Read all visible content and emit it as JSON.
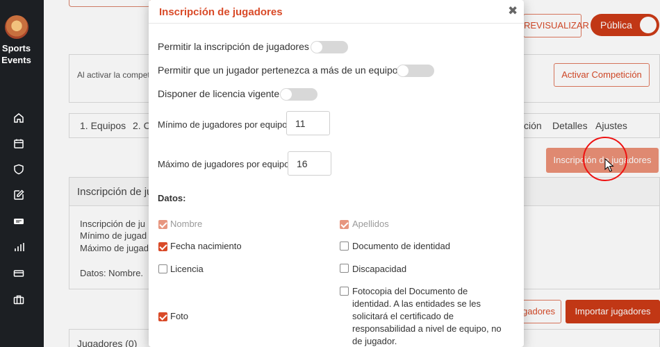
{
  "sidebar": {
    "brand": "Sports\nEvents",
    "brand_line1": "Sports",
    "brand_line2": "Events",
    "icons": [
      "home-icon",
      "calendar-icon",
      "shield-icon",
      "edit-icon",
      "ticket-icon",
      "bar-chart-icon",
      "card-icon",
      "briefcase-icon"
    ]
  },
  "header": {
    "previsualizar_label": "PREVISUALIZAR",
    "previsualizar_visible": "REVISUALIZAR",
    "publica_label": "Pública"
  },
  "activation": {
    "text": "Al activar la compet",
    "button_label": "Activar Competición"
  },
  "tabs": {
    "left": [
      "1. Equipos",
      "2. C"
    ],
    "right": [
      "ción",
      "Detalles",
      "Ajustes"
    ]
  },
  "inscripcion_button": "Inscripción de jugadores",
  "inscripcion_panel": {
    "title": "Inscripción de ju",
    "lines": [
      "Inscripción de ju",
      "Mínimo de jugad",
      "Máximo de jugad",
      "Datos: Nombre."
    ]
  },
  "import": {
    "ghost_label": "ugadores",
    "importar_label": "Importar jugadores"
  },
  "jugadores_title": "Jugadores (0)",
  "modal": {
    "title": "Inscripción de jugadores",
    "close": "✖",
    "toggles": [
      {
        "label": "Permitir la inscripción de jugadores",
        "on": false
      },
      {
        "label": "Permitir que un jugador pertenezca a más de un equipo",
        "on": false
      },
      {
        "label": "Disponer de licencia vigente",
        "on": false
      }
    ],
    "min_label": "Mínimo de jugadores por equipo",
    "min_value": "11",
    "max_label": "Máximo de jugadores por equipo",
    "max_value": "16",
    "datos_label": "Datos:",
    "checkboxes_left": [
      {
        "label": "Nombre",
        "checked": true,
        "disabled": true
      },
      {
        "label": "Fecha nacimiento",
        "checked": true,
        "disabled": false
      },
      {
        "label": "Licencia",
        "checked": false,
        "disabled": false
      },
      {
        "label": "Foto",
        "checked": true,
        "disabled": false
      }
    ],
    "checkboxes_right": [
      {
        "label": "Apellidos",
        "checked": true,
        "disabled": true
      },
      {
        "label": "Documento de identidad",
        "checked": false,
        "disabled": false
      },
      {
        "label": "Discapacidad",
        "checked": false,
        "disabled": false
      },
      {
        "label": "Fotocopia del Documento de identidad. A las entidades se les solicitará el certificado de responsabilidad a nivel de equipo, no de jugador.",
        "checked": false,
        "disabled": false
      }
    ]
  },
  "colors": {
    "accent": "#d94a28",
    "accent_dark": "#cc3a17",
    "sidebar_bg": "#1c1f23"
  }
}
